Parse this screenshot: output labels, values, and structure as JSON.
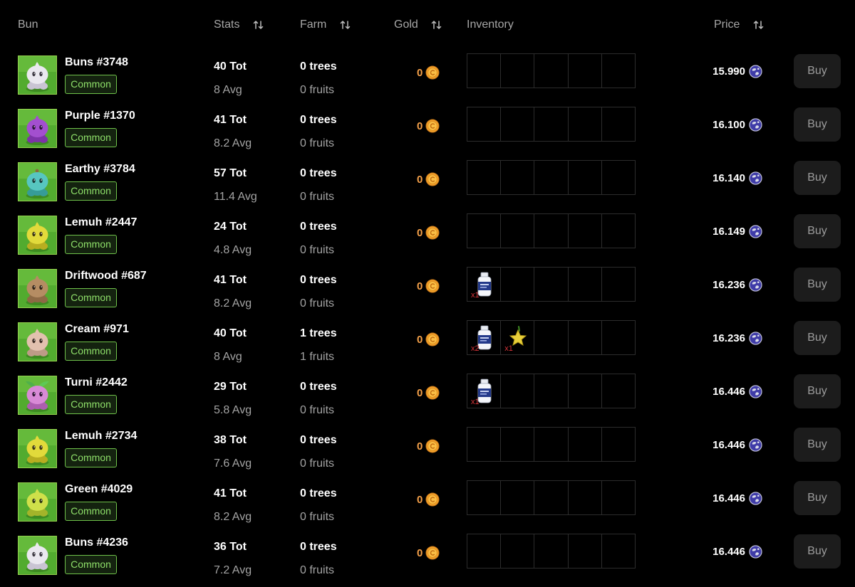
{
  "header": {
    "bun": "Bun",
    "stats": "Stats",
    "farm": "Farm",
    "gold": "Gold",
    "inventory": "Inventory",
    "price": "Price"
  },
  "colors": {
    "background": "#000000",
    "rarity_green": "#8fe06a",
    "gold_orange": "#f5a14a",
    "qty_red": "#d8353a"
  },
  "rows": [
    {
      "name": "Buns #3748",
      "rarity": "Common",
      "tot": "40 Tot",
      "avg": "8 Avg",
      "trees": "0 trees",
      "fruits": "0 fruits",
      "gold": "0",
      "price": "15.990",
      "buy": "Buy",
      "inventory": []
    },
    {
      "name": "Purple #1370",
      "rarity": "Common",
      "tot": "41 Tot",
      "avg": "8.2 Avg",
      "trees": "0 trees",
      "fruits": "0 fruits",
      "gold": "0",
      "price": "16.100",
      "buy": "Buy",
      "inventory": []
    },
    {
      "name": "Earthy #3784",
      "rarity": "Common",
      "tot": "57 Tot",
      "avg": "11.4 Avg",
      "trees": "0 trees",
      "fruits": "0 fruits",
      "gold": "0",
      "price": "16.140",
      "buy": "Buy",
      "inventory": []
    },
    {
      "name": "Lemuh #2447",
      "rarity": "Common",
      "tot": "24 Tot",
      "avg": "4.8 Avg",
      "trees": "0 trees",
      "fruits": "0 fruits",
      "gold": "0",
      "price": "16.149",
      "buy": "Buy",
      "inventory": []
    },
    {
      "name": "Driftwood #687",
      "rarity": "Common",
      "tot": "41 Tot",
      "avg": "8.2 Avg",
      "trees": "0 trees",
      "fruits": "0 fruits",
      "gold": "0",
      "price": "16.236",
      "buy": "Buy",
      "inventory": [
        {
          "icon": "potion-bottle-icon",
          "qty": "x1"
        }
      ]
    },
    {
      "name": "Cream #971",
      "rarity": "Common",
      "tot": "40 Tot",
      "avg": "8 Avg",
      "trees": "1 trees",
      "fruits": "1 fruits",
      "gold": "0",
      "price": "16.236",
      "buy": "Buy",
      "inventory": [
        {
          "icon": "potion-bottle-icon",
          "qty": "x2"
        },
        {
          "icon": "star-fruit-icon",
          "qty": "x1"
        }
      ]
    },
    {
      "name": "Turni #2442",
      "rarity": "Common",
      "tot": "29 Tot",
      "avg": "5.8 Avg",
      "trees": "0 trees",
      "fruits": "0 fruits",
      "gold": "0",
      "price": "16.446",
      "buy": "Buy",
      "inventory": [
        {
          "icon": "potion-bottle-icon",
          "qty": "x1"
        }
      ]
    },
    {
      "name": "Lemuh #2734",
      "rarity": "Common",
      "tot": "38 Tot",
      "avg": "7.6 Avg",
      "trees": "0 trees",
      "fruits": "0 fruits",
      "gold": "0",
      "price": "16.446",
      "buy": "Buy",
      "inventory": []
    },
    {
      "name": "Green #4029",
      "rarity": "Common",
      "tot": "41 Tot",
      "avg": "8.2 Avg",
      "trees": "0 trees",
      "fruits": "0 fruits",
      "gold": "0",
      "price": "16.446",
      "buy": "Buy",
      "inventory": []
    },
    {
      "name": "Buns #4236",
      "rarity": "Common",
      "tot": "36 Tot",
      "avg": "7.2 Avg",
      "trees": "0 trees",
      "fruits": "0 fruits",
      "gold": "0",
      "price": "16.446",
      "buy": "Buy",
      "inventory": []
    }
  ]
}
